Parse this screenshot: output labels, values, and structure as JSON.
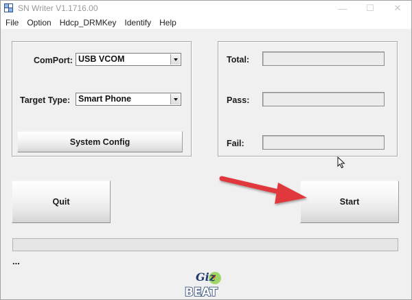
{
  "window": {
    "title": "SN Writer V1.1716.00",
    "controls": {
      "minimize_glyph": "—",
      "maximize_glyph": "☐",
      "close_glyph": "✕"
    }
  },
  "menu": [
    {
      "label": "File"
    },
    {
      "label": "Option"
    },
    {
      "label": "Hdcp_DRMKey"
    },
    {
      "label": "Identify"
    },
    {
      "label": "Help"
    }
  ],
  "config": {
    "comport_label": "ComPort:",
    "comport_value": "USB VCOM",
    "target_type_label": "Target Type:",
    "target_type_value": "Smart Phone",
    "system_config_label": "System Config"
  },
  "stats": {
    "total_label": "Total:",
    "total_value": "",
    "pass_label": "Pass:",
    "pass_value": "",
    "fail_label": "Fail:",
    "fail_value": ""
  },
  "actions": {
    "quit_label": "Quit",
    "start_label": "Start"
  },
  "progress": {
    "fraction": 0
  },
  "status_text": "...",
  "colors": {
    "annotation_arrow": "#e0393c",
    "window_bg": "#f0f0f0"
  },
  "icons": {
    "app": "app-logo-icon",
    "cursor": "mouse-pointer-icon",
    "watermark": "gizbeat-watermark-logo"
  },
  "watermark_text": {
    "line1": "Giz",
    "line2": "BEAT"
  }
}
